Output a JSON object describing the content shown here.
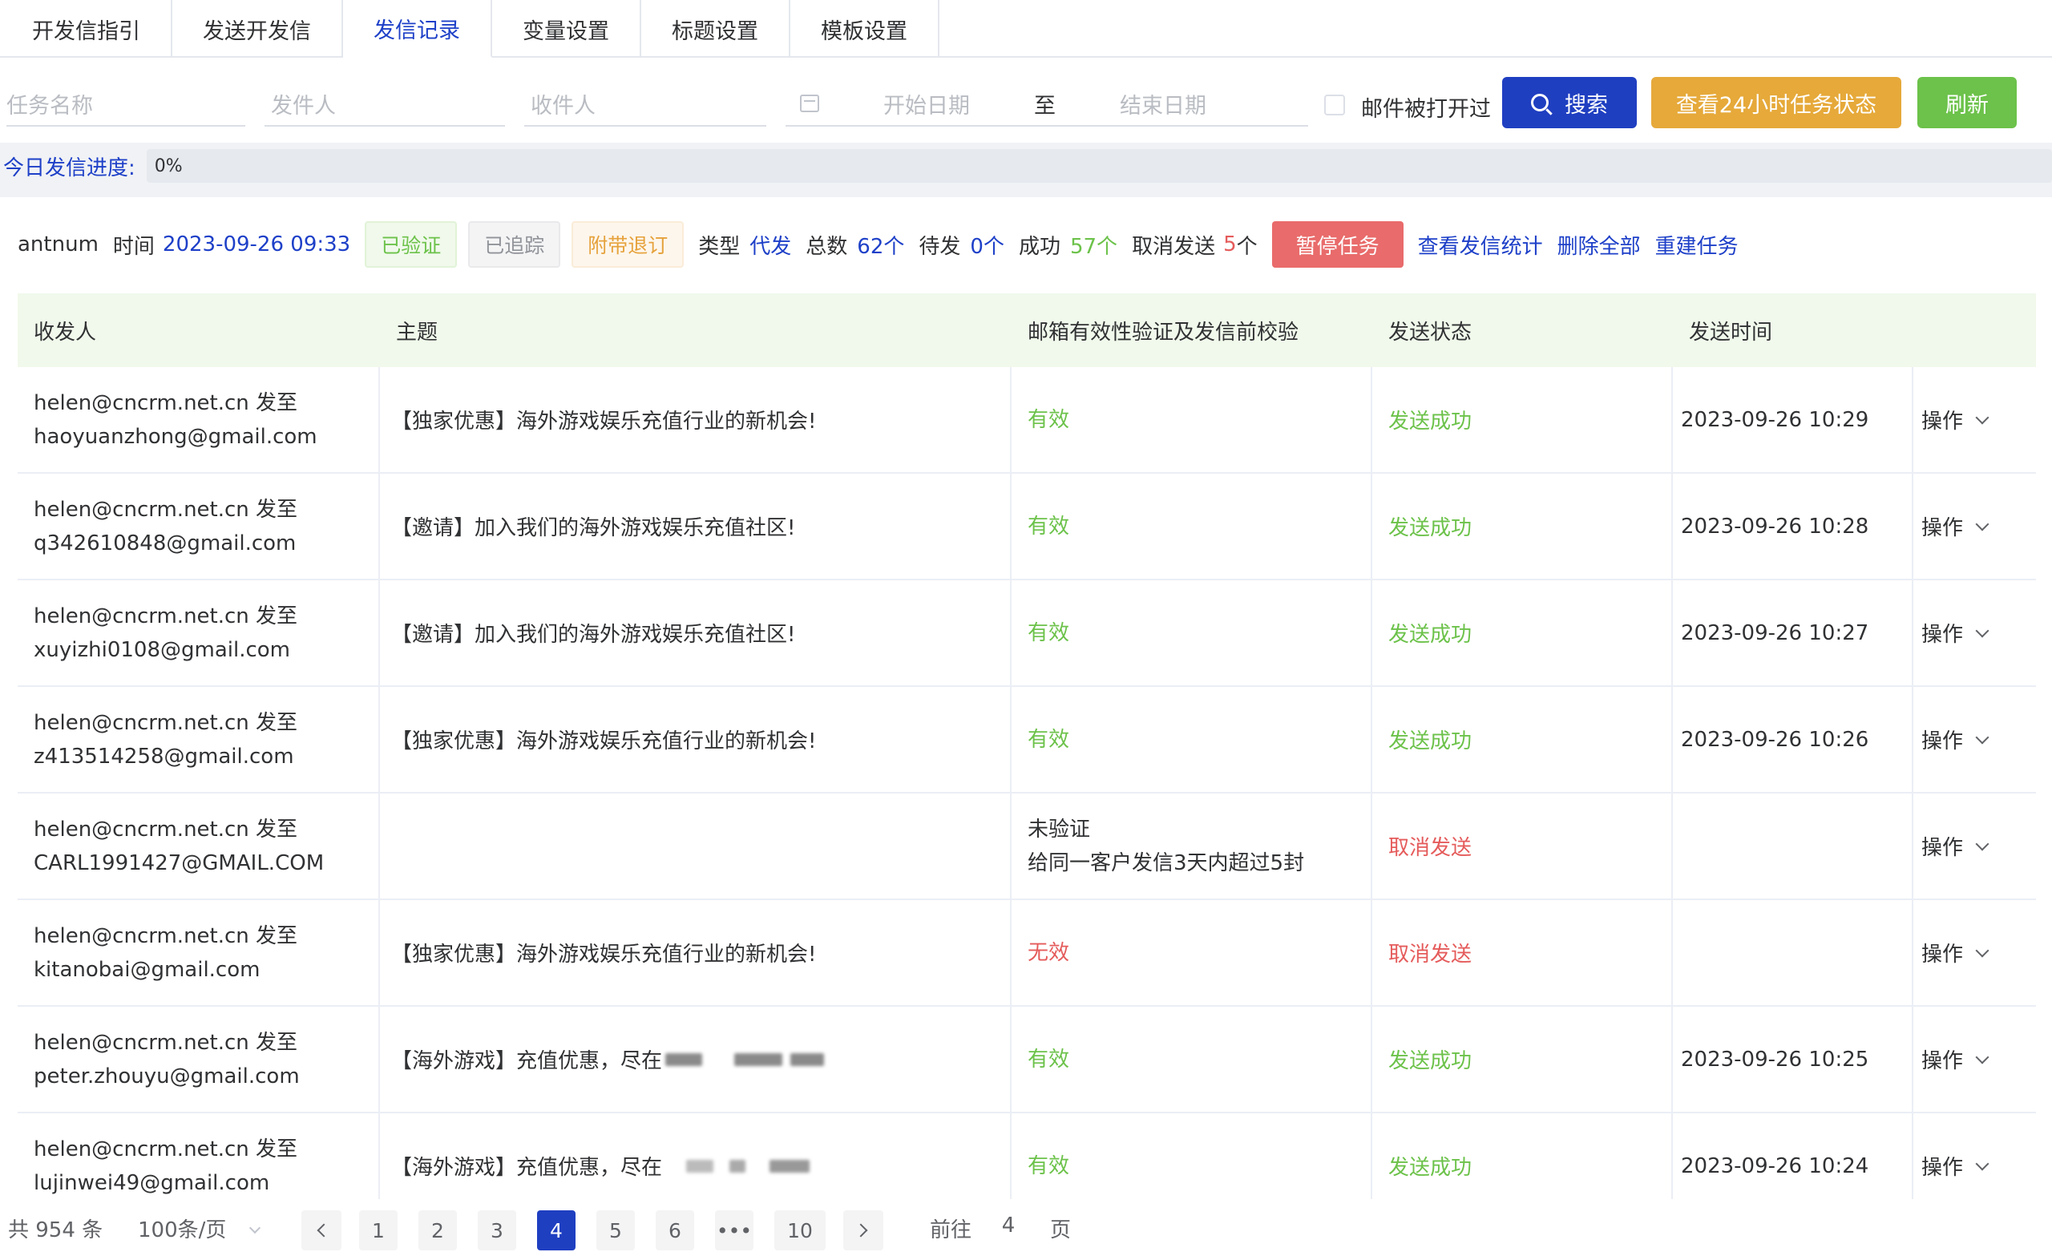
{
  "tabs": [
    "开发信指引",
    "发送开发信",
    "发信记录",
    "变量设置",
    "标题设置",
    "模板设置"
  ],
  "filter": {
    "task_name_placeholder": "任务名称",
    "sender_placeholder": "发件人",
    "recipient_placeholder": "收件人",
    "start_date_placeholder": "开始日期",
    "to_label": "至",
    "end_date_placeholder": "结束日期",
    "opened_label": "邮件被打开过",
    "search_label": "搜索",
    "status_label": "查看24小时任务状态",
    "refresh_label": "刷新"
  },
  "progress": {
    "label": "今日发信进度:",
    "value": "0%"
  },
  "task": {
    "name": "antnum",
    "time_label": "时间",
    "time": "2023-09-26 09:33",
    "tag_verified": "已验证",
    "tag_tracked": "已追踪",
    "tag_unsub": "附带退订",
    "type_label": "类型",
    "type": "代发",
    "total_label": "总数",
    "total": "62个",
    "pending_label": "待发",
    "pending": "0个",
    "success_label": "成功",
    "success": "57个",
    "cancel_label": "取消发送",
    "cancel_num": "5",
    "cancel_unit": "个",
    "pause_label": "暂停任务",
    "stats_link": "查看发信统计",
    "delete_link": "删除全部",
    "rebuild_link": "重建任务"
  },
  "table": {
    "headers": [
      "收发人",
      "主题",
      "邮箱有效性验证及发信前校验",
      "发送状态",
      "发送时间"
    ],
    "op_label": "操作",
    "rows": [
      {
        "from": "helen@cncrm.net.cn 发至",
        "to": "haoyuanzhong@gmail.com",
        "subject": "【独家优惠】海外游戏娱乐充值行业的新机会!",
        "valid": "有效",
        "valid2": "",
        "status": "发送成功",
        "time": "2023-09-26 10:29"
      },
      {
        "from": "helen@cncrm.net.cn 发至",
        "to": "q342610848@gmail.com",
        "subject": "【邀请】加入我们的海外游戏娱乐充值社区!",
        "valid": "有效",
        "valid2": "",
        "status": "发送成功",
        "time": "2023-09-26 10:28"
      },
      {
        "from": "helen@cncrm.net.cn 发至",
        "to": "xuyizhi0108@gmail.com",
        "subject": "【邀请】加入我们的海外游戏娱乐充值社区!",
        "valid": "有效",
        "valid2": "",
        "status": "发送成功",
        "time": "2023-09-26 10:27"
      },
      {
        "from": "helen@cncrm.net.cn 发至",
        "to": "z413514258@gmail.com",
        "subject": "【独家优惠】海外游戏娱乐充值行业的新机会!",
        "valid": "有效",
        "valid2": "",
        "status": "发送成功",
        "time": "2023-09-26 10:26"
      },
      {
        "from": "helen@cncrm.net.cn 发至",
        "to": "CARL1991427@GMAIL.COM",
        "subject": "",
        "valid": "未验证",
        "valid2": "给同一客户发信3天内超过5封",
        "status": "取消发送",
        "time": ""
      },
      {
        "from": "helen@cncrm.net.cn 发至",
        "to": "kitanobai@gmail.com",
        "subject": "【独家优惠】海外游戏娱乐充值行业的新机会!",
        "valid": "无效",
        "valid2": "",
        "status": "取消发送",
        "time": ""
      },
      {
        "from": "helen@cncrm.net.cn 发至",
        "to": "peter.zhouyu@gmail.com",
        "subject": "【海外游戏】充值优惠，尽在",
        "valid": "有效",
        "valid2": "",
        "status": "发送成功",
        "time": "2023-09-26 10:25"
      },
      {
        "from": "helen@cncrm.net.cn 发至",
        "to": "lujinwei49@gmail.com",
        "subject": "【海外游戏】充值优惠，尽在",
        "valid": "有效",
        "valid2": "",
        "status": "发送成功",
        "time": "2023-09-26 10:24"
      }
    ]
  },
  "pager": {
    "total": "共 954 条",
    "page_size": "100条/页",
    "pages": [
      "1",
      "2",
      "3",
      "4",
      "5",
      "6",
      "•••",
      "10"
    ],
    "current": "4",
    "goto_label": "前往",
    "goto_value": "4",
    "page_unit": "页"
  },
  "colors": {
    "primary": "#1f3fc1",
    "success": "#6cc24a",
    "danger": "#e55b5b",
    "warning": "#e6a93a"
  }
}
